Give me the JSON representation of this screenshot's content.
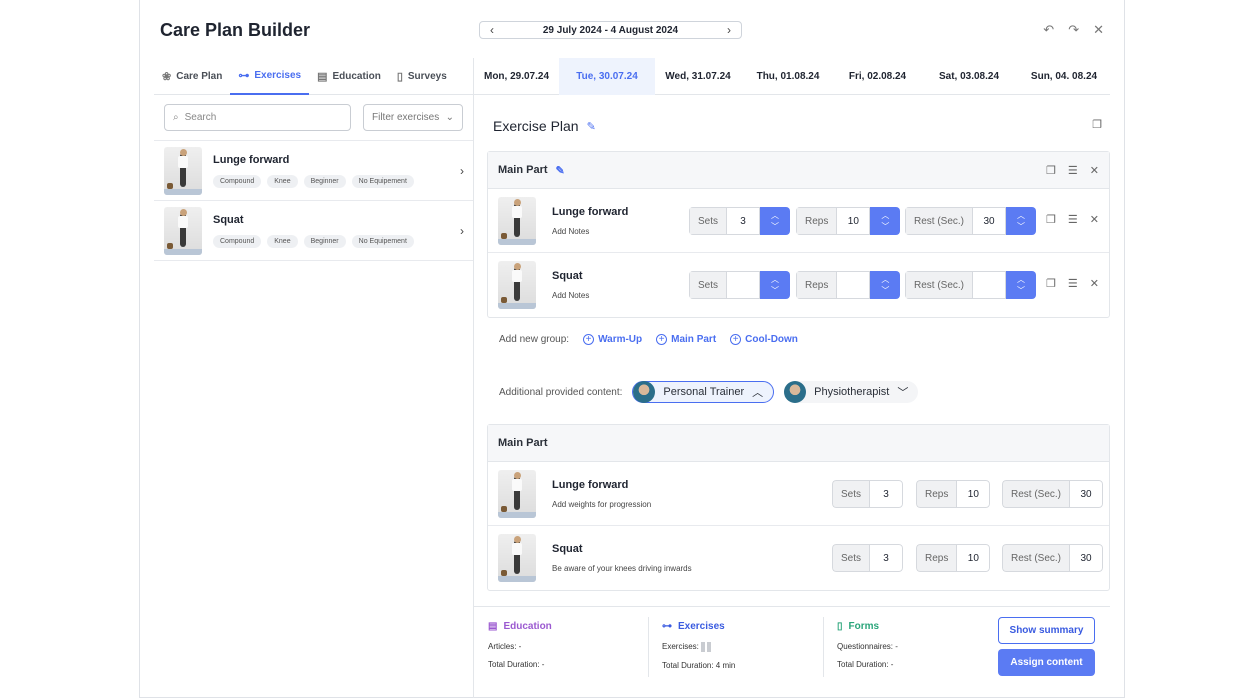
{
  "app": {
    "title": "Care Plan Builder"
  },
  "dates": {
    "range": "29 July 2024 - 4 August 2024",
    "prev": "‹",
    "next": "›"
  },
  "window_icons": [
    "undo-icon",
    "redo-icon",
    "close-icon"
  ],
  "left_tabs": [
    {
      "label": "Care Plan",
      "icon": "care-plan-icon",
      "active": false
    },
    {
      "label": "Exercises",
      "icon": "dumbbell-icon",
      "active": true
    },
    {
      "label": "Education",
      "icon": "book-icon",
      "active": false
    },
    {
      "label": "Surveys",
      "icon": "clipboard-icon",
      "active": false
    }
  ],
  "search": {
    "placeholder": "Search"
  },
  "filter": {
    "label": "Filter exercises"
  },
  "exercise_library": [
    {
      "name": "Lunge forward",
      "tags": [
        "Compound",
        "Knee",
        "Beginner",
        "No Equipement"
      ]
    },
    {
      "name": "Squat",
      "tags": [
        "Compound",
        "Knee",
        "Beginner",
        "No Equipement"
      ]
    }
  ],
  "days": [
    {
      "label": "Mon, 29.07.24",
      "active": false
    },
    {
      "label": "Tue, 30.07.24",
      "active": true
    },
    {
      "label": "Wed, 31.07.24",
      "active": false
    },
    {
      "label": "Thu, 01.08.24",
      "active": false
    },
    {
      "label": "Fri, 02.08.24",
      "active": false
    },
    {
      "label": "Sat, 03.08.24",
      "active": false
    },
    {
      "label": "Sun, 04. 08.24",
      "active": false
    }
  ],
  "plan": {
    "title": "Exercise Plan",
    "group": {
      "title": "Main Part",
      "rows": [
        {
          "name": "Lunge forward",
          "note": "Add Notes",
          "sets_label": "Sets",
          "sets": "3",
          "reps_label": "Reps",
          "reps": "10",
          "rest_label": "Rest (Sec.)",
          "rest": "30"
        },
        {
          "name": "Squat",
          "note": "Add Notes",
          "sets_label": "Sets",
          "sets": "",
          "reps_label": "Reps",
          "reps": "",
          "rest_label": "Rest (Sec.)",
          "rest": ""
        }
      ]
    },
    "add_group": {
      "label": "Add new group:",
      "options": [
        "Warm-Up",
        "Main Part",
        "Cool-Down"
      ]
    },
    "provided": {
      "label": "Additional provided content:",
      "options": [
        {
          "label": "Personal Trainer",
          "active": true,
          "chevron": "chevron-up-icon"
        },
        {
          "label": "Physiotherapist",
          "active": false,
          "chevron": "chevron-down-icon"
        }
      ]
    },
    "provided_group": {
      "title": "Main Part",
      "rows": [
        {
          "name": "Lunge forward",
          "note": "Add weights for progression",
          "sets_label": "Sets",
          "sets": "3",
          "reps_label": "Reps",
          "reps": "10",
          "rest_label": "Rest (Sec.)",
          "rest": "30"
        },
        {
          "name": "Squat",
          "note": "Be aware of your knees driving inwards",
          "sets_label": "Sets",
          "sets": "3",
          "reps_label": "Reps",
          "reps": "10",
          "rest_label": "Rest (Sec.)",
          "rest": "30"
        }
      ]
    }
  },
  "summary": {
    "education": {
      "title": "Education",
      "line1": "Articles: -",
      "line2": "Total Duration: -",
      "color": "#9b59d0"
    },
    "exercises": {
      "title": "Exercises",
      "line1": "Exercises:",
      "line2": "Total Duration: 4 min",
      "color": "#3a5be0"
    },
    "forms": {
      "title": "Forms",
      "line1": "Questionnaires: -",
      "line2": "Total Duration: -",
      "color": "#2aa57a"
    },
    "show_summary": "Show summary",
    "assign": "Assign content"
  },
  "colors": {
    "accent": "#4a6ef0",
    "spinner": "#5b7bf3"
  }
}
